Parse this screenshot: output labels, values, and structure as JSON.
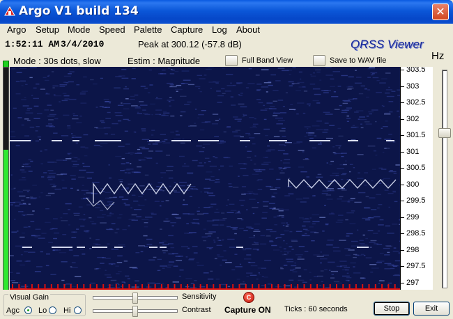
{
  "window": {
    "title": "Argo V1 build 134",
    "close_glyph": "✕"
  },
  "menu": [
    "Argo",
    "Setup",
    "Mode",
    "Speed",
    "Palette",
    "Capture",
    "Log",
    "About"
  ],
  "info": {
    "time": "1:52:11 AM",
    "date": "3/4/2010",
    "peak": "Peak at  300.12 (-57.8 dB)",
    "brand": "QRSS Viewer",
    "mode": "Mode : 30s dots, slow",
    "estim": "Estim : Magnitude",
    "full_band": "Full Band View",
    "save_wav": "Save to WAV file",
    "unit": "Hz"
  },
  "scale_labels": [
    "303.5",
    "303",
    "302.5",
    "302",
    "301.5",
    "301",
    "300.5",
    "300",
    "299.5",
    "299",
    "298.5",
    "298",
    "297.5",
    "297"
  ],
  "audio_level": 0.63,
  "bottom": {
    "visual_gain_title": "Visual Gain",
    "agc_label": "Agc",
    "lo_label": "Lo",
    "hi_label": "Hi",
    "selected": "agc",
    "sensitivity_label": "Sensitivity",
    "contrast_label": "Contrast",
    "capture_glyph": "C",
    "capture_status": "Capture ON",
    "ticks_text": "Ticks   : 60 seconds",
    "stop_label": "Stop",
    "exit_label": "Exit"
  },
  "colors": {
    "waterfall_bg": "#0c1548",
    "trace": "#e8ecff",
    "tick_marks": "#d81010",
    "level": "#2fe82f"
  }
}
